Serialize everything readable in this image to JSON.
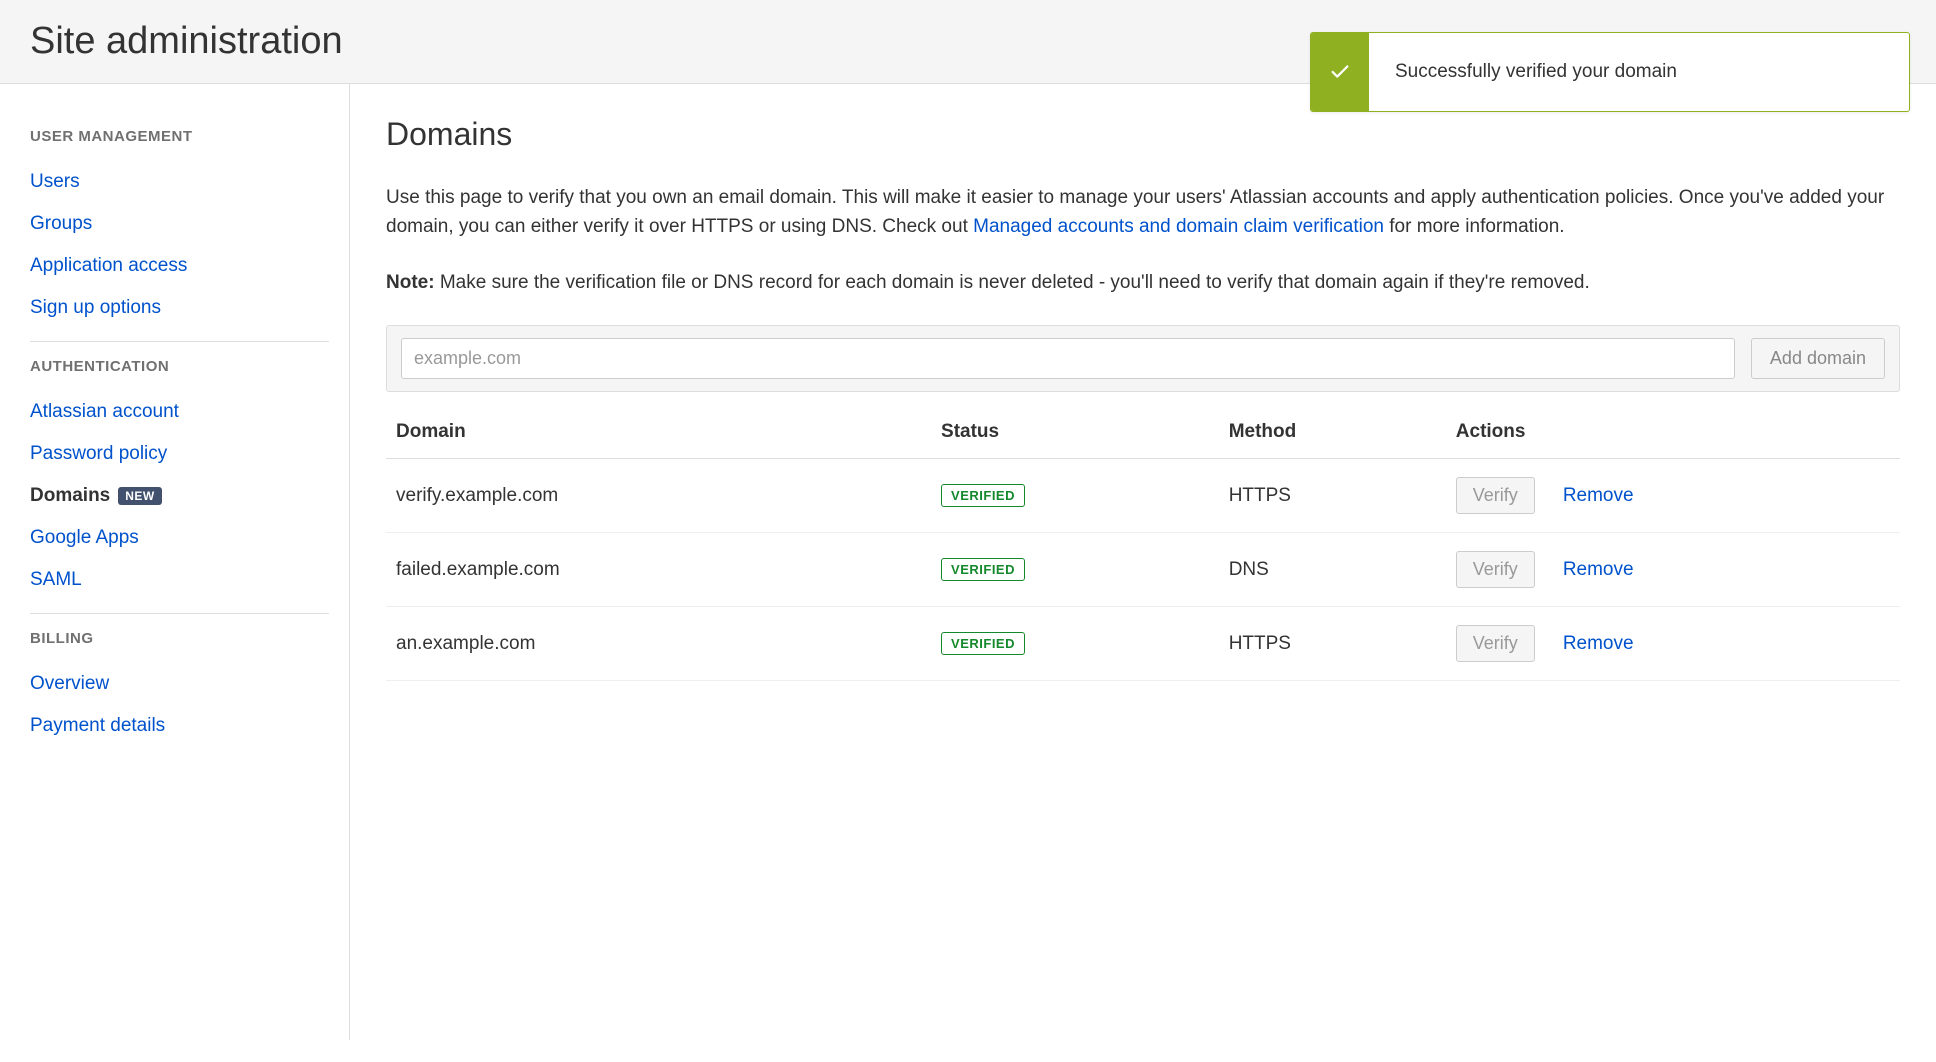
{
  "header": {
    "title": "Site administration"
  },
  "toast": {
    "message": "Successfully verified your domain"
  },
  "sidebar": {
    "sections": [
      {
        "heading": "USER MANAGEMENT",
        "items": [
          {
            "label": "Users"
          },
          {
            "label": "Groups"
          },
          {
            "label": "Application access"
          },
          {
            "label": "Sign up options"
          }
        ]
      },
      {
        "heading": "AUTHENTICATION",
        "items": [
          {
            "label": "Atlassian account"
          },
          {
            "label": "Password policy"
          },
          {
            "label": "Domains",
            "badge": "NEW",
            "active": true
          },
          {
            "label": "Google Apps"
          },
          {
            "label": "SAML"
          }
        ]
      },
      {
        "heading": "BILLING",
        "items": [
          {
            "label": "Overview"
          },
          {
            "label": "Payment details"
          }
        ]
      }
    ]
  },
  "main": {
    "heading": "Domains",
    "description_pre": "Use this page to verify that you own an email domain. This will make it easier to manage your users' Atlassian accounts and apply authentication policies. Once you've added your domain, you can either verify it over HTTPS or using DNS. Check out ",
    "description_link": "Managed accounts and domain claim verification",
    "description_post": " for more information.",
    "note_label": "Note:",
    "note_text": " Make sure the verification file or DNS record for each domain is never deleted - you'll need to verify that domain again if they're removed.",
    "input_placeholder": "example.com",
    "add_button": "Add domain",
    "table": {
      "columns": [
        "Domain",
        "Status",
        "Method",
        "Actions"
      ],
      "rows": [
        {
          "domain": "verify.example.com",
          "status": "VERIFIED",
          "method": "HTTPS"
        },
        {
          "domain": "failed.example.com",
          "status": "VERIFIED",
          "method": "DNS"
        },
        {
          "domain": "an.example.com",
          "status": "VERIFIED",
          "method": "HTTPS"
        }
      ],
      "verify_label": "Verify",
      "remove_label": "Remove"
    }
  }
}
